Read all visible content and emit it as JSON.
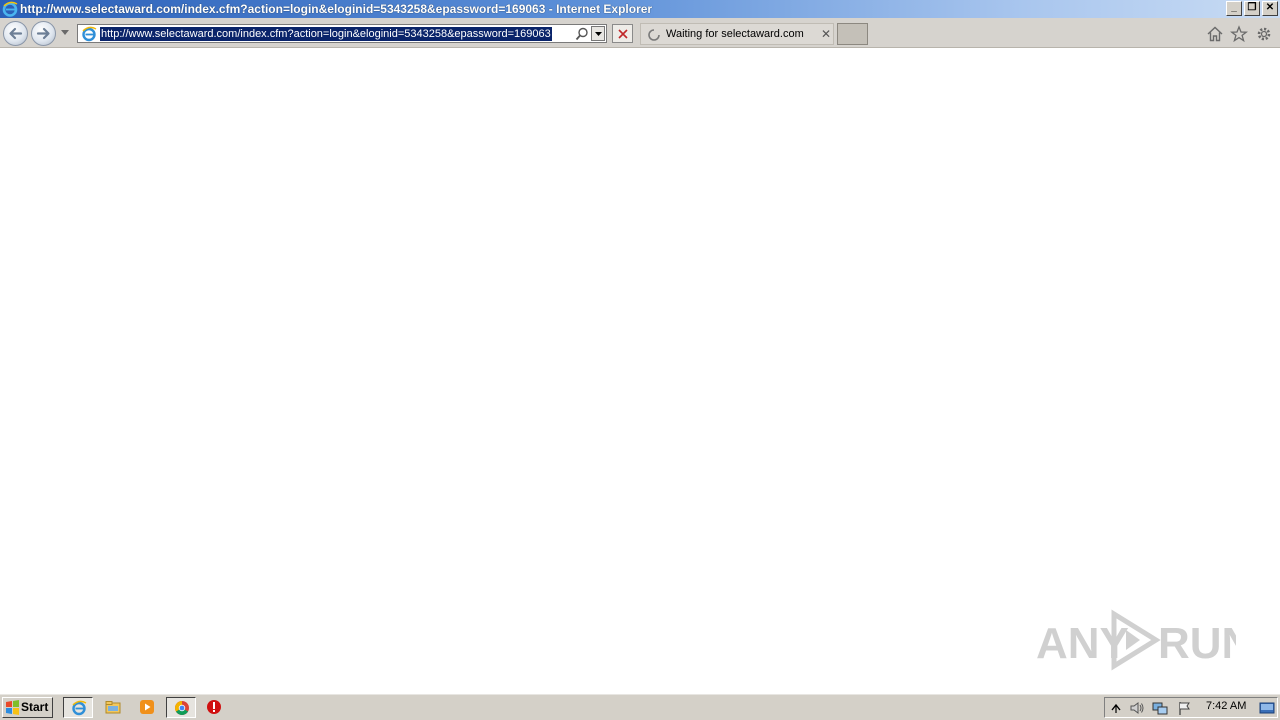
{
  "window": {
    "title": "http://www.selectaward.com/index.cfm?action=login&eloginid=5343258&epassword=169063 - Internet Explorer",
    "controls": {
      "minimize": "_",
      "restore": "❐",
      "close": "✕"
    }
  },
  "navbar": {
    "address_url": "http://www.selectaward.com/index.cfm?action=login&eloginid=5343258&epassword=169063",
    "tab_label": "Waiting for selectaward.com",
    "tab_close": "✕"
  },
  "watermark": {
    "text_left": "ANY",
    "text_right": "RUN"
  },
  "taskbar": {
    "start_label": "Start",
    "clock": "7:42 AM"
  },
  "colors": {
    "titlebar_start": "#2a5fb8",
    "chrome_gray": "#d4d0c8",
    "selection": "#0a246a",
    "stop_red": "#c0282a"
  },
  "icons": [
    "ie-logo-icon",
    "back-arrow-icon",
    "forward-arrow-icon",
    "search-icon",
    "stop-icon",
    "loading-spinner-icon",
    "home-icon",
    "favorites-star-icon",
    "settings-gear-icon",
    "windows-logo-icon",
    "explorer-folder-icon",
    "media-player-icon",
    "chrome-icon",
    "stop-sign-icon",
    "tray-arrow-icon",
    "volume-icon",
    "network-icon",
    "action-center-flag-icon",
    "show-desktop-icon"
  ]
}
